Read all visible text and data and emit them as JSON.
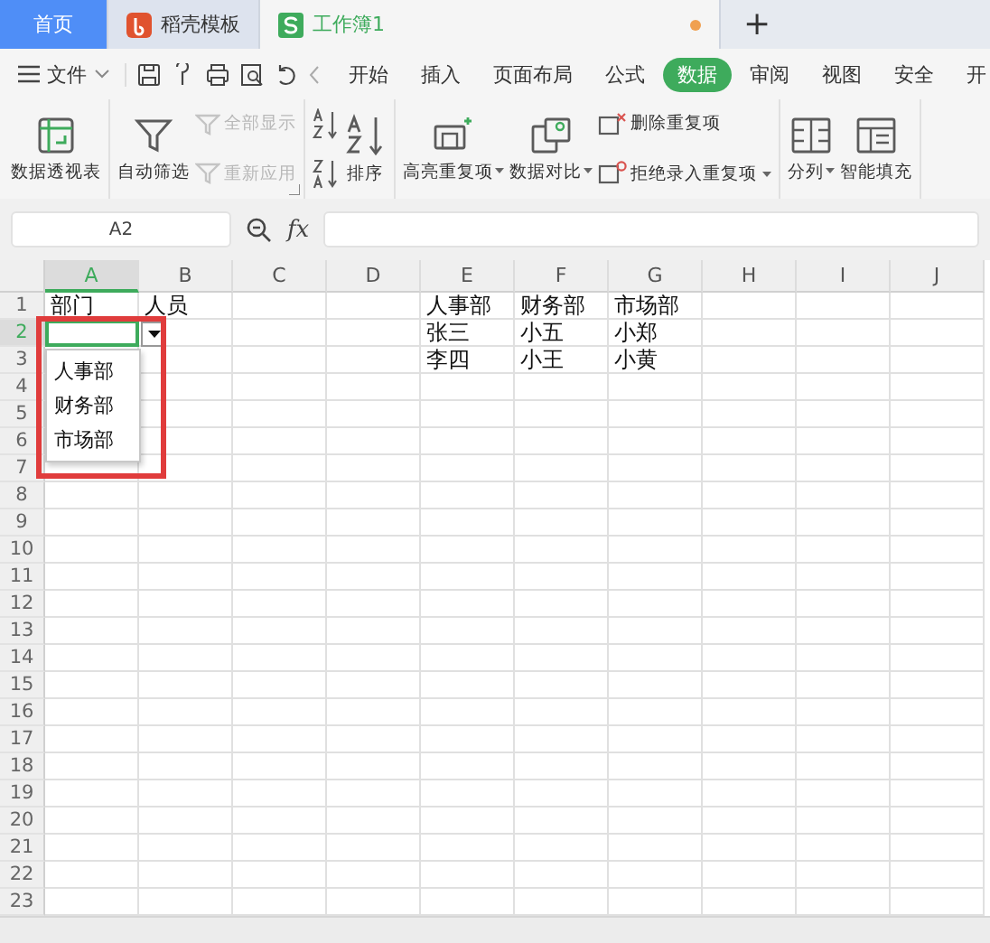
{
  "tabs": [
    {
      "label": "首页",
      "kind": "home",
      "selected": false
    },
    {
      "label": "稻壳模板",
      "kind": "docer",
      "selected": false
    },
    {
      "label": "工作簿1",
      "kind": "sheet",
      "selected": true,
      "modified": true
    }
  ],
  "new_tab": "+",
  "menu": {
    "file": "文件",
    "tabs": [
      {
        "label": "开始",
        "selected": false
      },
      {
        "label": "插入",
        "selected": false
      },
      {
        "label": "页面布局",
        "selected": false
      },
      {
        "label": "公式",
        "selected": false
      },
      {
        "label": "数据",
        "selected": true
      },
      {
        "label": "审阅",
        "selected": false
      },
      {
        "label": "视图",
        "selected": false
      },
      {
        "label": "安全",
        "selected": false
      },
      {
        "label": "开",
        "selected": false
      }
    ]
  },
  "ribbon": {
    "groups": [
      {
        "columns": [
          [
            {
              "kind": "large",
              "label": "数据透视表",
              "caret": false,
              "disabled": false
            }
          ]
        ]
      },
      {
        "launcher": true,
        "columns": [
          [
            {
              "kind": "large",
              "label": "自动筛选",
              "caret": false,
              "disabled": false
            }
          ],
          [
            {
              "kind": "small",
              "label": "全部显示",
              "caret": false,
              "disabled": true
            },
            {
              "kind": "small",
              "label": "重新应用",
              "caret": false,
              "disabled": true
            }
          ]
        ]
      },
      {
        "columns": [
          [
            {
              "kind": "icon",
              "caret": false,
              "disabled": false
            },
            {
              "kind": "icon",
              "caret": false,
              "disabled": false
            }
          ],
          [
            {
              "kind": "large",
              "label": "排序",
              "caret": false,
              "disabled": false
            }
          ]
        ]
      },
      {
        "columns": [
          [
            {
              "kind": "large",
              "label": "高亮重复项",
              "caret": true,
              "disabled": false
            }
          ],
          [
            {
              "kind": "large",
              "label": "数据对比",
              "caret": true,
              "disabled": false
            }
          ],
          [
            {
              "kind": "small",
              "label": "删除重复项",
              "caret": false,
              "disabled": false
            },
            {
              "kind": "small",
              "label": "拒绝录入重复项",
              "caret": true,
              "disabled": false
            }
          ]
        ]
      },
      {
        "columns": [
          [
            {
              "kind": "large",
              "label": "分列",
              "caret": true,
              "disabled": false
            }
          ],
          [
            {
              "kind": "large",
              "label": "智能填充",
              "caret": false,
              "disabled": false
            }
          ]
        ]
      }
    ]
  },
  "formula_bar": {
    "name_box": "A2",
    "fx": "fx"
  },
  "sheet": {
    "columns": [
      {
        "label": "A",
        "selected": true
      },
      {
        "label": "B",
        "selected": false
      },
      {
        "label": "C",
        "selected": false
      },
      {
        "label": "D",
        "selected": false
      },
      {
        "label": "E",
        "selected": false
      },
      {
        "label": "F",
        "selected": false
      },
      {
        "label": "G",
        "selected": false
      },
      {
        "label": "H",
        "selected": false
      },
      {
        "label": "I",
        "selected": false
      },
      {
        "label": "J",
        "selected": false
      }
    ],
    "rows": [
      {
        "label": "1",
        "selected": false,
        "cells": {
          "A": "部门",
          "B": "人员",
          "E": "人事部",
          "F": "财务部",
          "G": "市场部"
        }
      },
      {
        "label": "2",
        "selected": true,
        "cells": {
          "E": "张三",
          "F": "小五",
          "G": "小郑"
        }
      },
      {
        "label": "3",
        "selected": false,
        "cells": {
          "E": "李四",
          "F": "小王",
          "G": "小黄"
        }
      },
      {
        "label": "4",
        "selected": false,
        "cells": {}
      },
      {
        "label": "5",
        "selected": false,
        "cells": {}
      },
      {
        "label": "6",
        "selected": false,
        "cells": {}
      },
      {
        "label": "7",
        "selected": false,
        "cells": {}
      },
      {
        "label": "8",
        "selected": false,
        "cells": {}
      },
      {
        "label": "9",
        "selected": false,
        "cells": {}
      },
      {
        "label": "10",
        "selected": false,
        "cells": {}
      },
      {
        "label": "11",
        "selected": false,
        "cells": {}
      },
      {
        "label": "12",
        "selected": false,
        "cells": {}
      },
      {
        "label": "13",
        "selected": false,
        "cells": {}
      },
      {
        "label": "14",
        "selected": false,
        "cells": {}
      },
      {
        "label": "15",
        "selected": false,
        "cells": {}
      },
      {
        "label": "16",
        "selected": false,
        "cells": {}
      },
      {
        "label": "17",
        "selected": false,
        "cells": {}
      },
      {
        "label": "18",
        "selected": false,
        "cells": {}
      },
      {
        "label": "19",
        "selected": false,
        "cells": {}
      },
      {
        "label": "20",
        "selected": false,
        "cells": {}
      },
      {
        "label": "21",
        "selected": false,
        "cells": {}
      },
      {
        "label": "22",
        "selected": false,
        "cells": {}
      },
      {
        "label": "23",
        "selected": false,
        "cells": {}
      }
    ],
    "dropdown": {
      "items": [
        "人事部",
        "财务部",
        "市场部"
      ]
    }
  }
}
